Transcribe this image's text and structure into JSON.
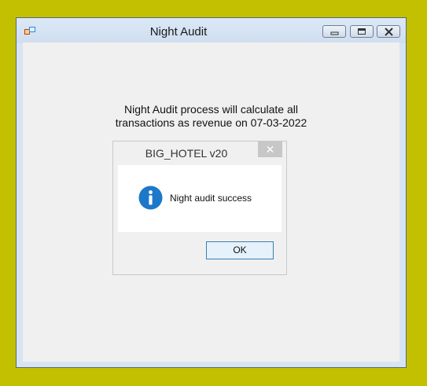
{
  "window": {
    "title": "Night Audit",
    "icons": [
      "app-icon",
      "minimize-icon",
      "maximize-icon",
      "close-icon"
    ]
  },
  "main": {
    "process_message_line1": "Night Audit process will calculate all",
    "process_message_line2": "transactions as revenue on 07-03-2022"
  },
  "dialog": {
    "title": "BIG_HOTEL v20",
    "close_glyph": "✕",
    "icon": "info-icon",
    "message": "Night audit success",
    "ok_label": "OK"
  },
  "colors": {
    "desktop": "#c2c000",
    "info_icon": "#1d78c9",
    "ok_border": "#3c7fb1"
  }
}
